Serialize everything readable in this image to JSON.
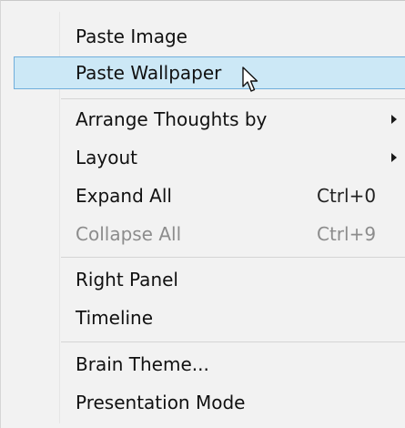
{
  "menu": {
    "paste_image": "Paste Image",
    "paste_wallpaper": "Paste Wallpaper",
    "arrange_thoughts_by": "Arrange Thoughts by",
    "layout": "Layout",
    "expand_all": "Expand All",
    "expand_all_shortcut": "Ctrl+0",
    "collapse_all": "Collapse All",
    "collapse_all_shortcut": "Ctrl+9",
    "right_panel": "Right Panel",
    "timeline": "Timeline",
    "brain_theme": "Brain Theme...",
    "presentation_mode": "Presentation Mode"
  },
  "state": {
    "highlighted_item": "Paste Wallpaper",
    "disabled_items": [
      "Collapse All"
    ]
  },
  "colors": {
    "menu_background": "#f2f2f2",
    "highlight_fill": "#cce8f6",
    "highlight_border": "#71aedb",
    "disabled_text": "#8c8c8c"
  },
  "icons": {
    "submenu": "submenu-arrow-icon",
    "pointer": "mouse-pointer-icon"
  }
}
